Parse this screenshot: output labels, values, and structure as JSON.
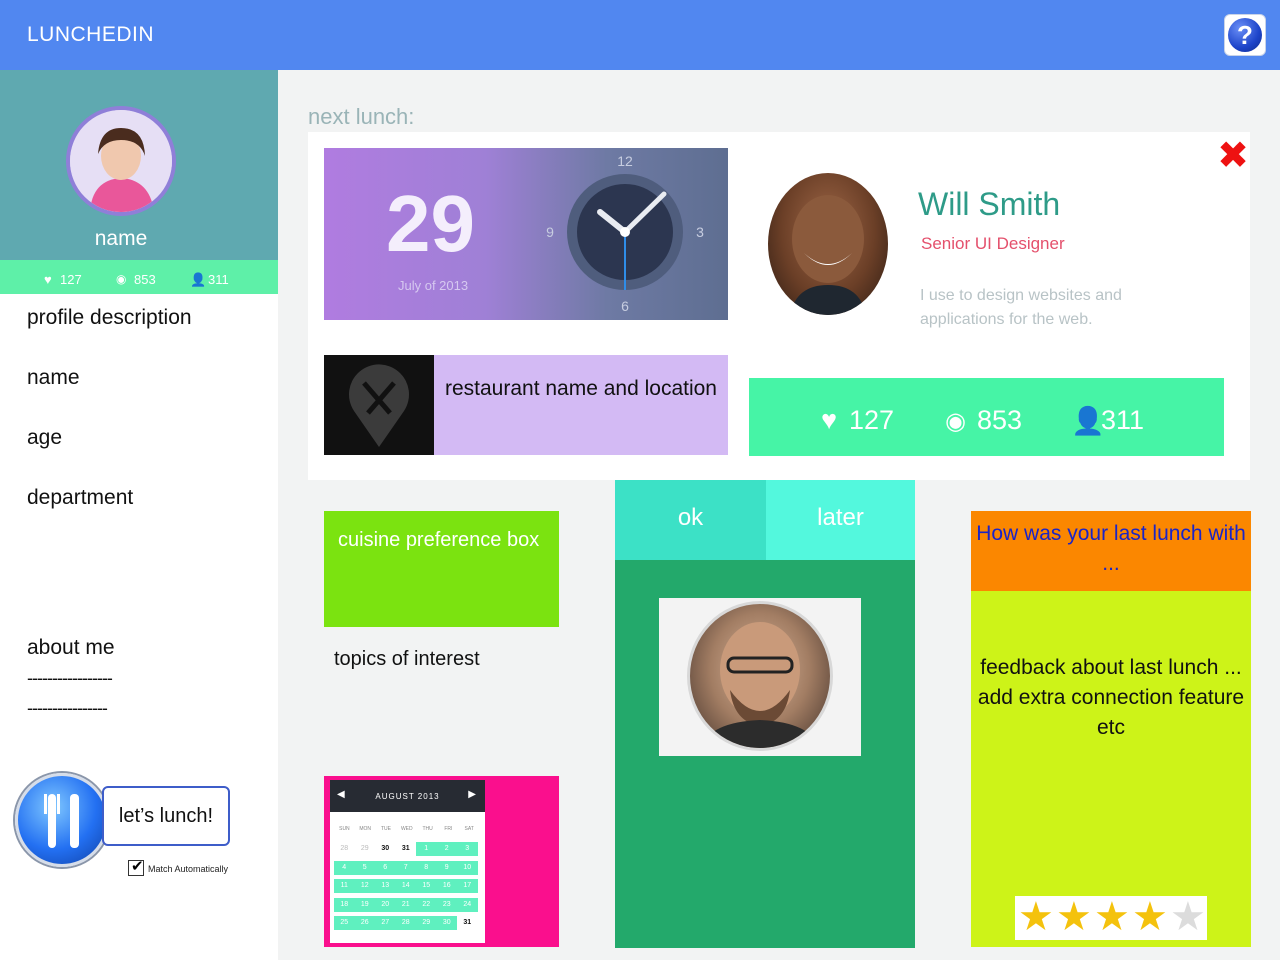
{
  "header": {
    "title": "LUNCHEDIN",
    "help_glyph": "?"
  },
  "sidebar": {
    "profile_name": "name",
    "stats": {
      "likes": "127",
      "views": "853",
      "friends": "311"
    },
    "labels": [
      "profile description",
      "name",
      "age",
      "department"
    ],
    "about_label": "about me",
    "dash_1": "-----------------",
    "dash_2": "----------------",
    "lunch_button": "let’s lunch!",
    "match_auto": "Match Automatically",
    "match_checked": true
  },
  "next_lunch": {
    "label": "next lunch:",
    "day": "29",
    "date_text": "July of 2013",
    "clock_numbers": {
      "twelve": "12",
      "three": "3",
      "six": "6",
      "nine": "9"
    },
    "restaurant": "restaurant name and location",
    "person": {
      "name": "Will Smith",
      "title": "Senior UI Designer",
      "description": "I use to design websites and applications for the web."
    },
    "stats": {
      "likes": "127",
      "views": "853",
      "friends": "311"
    }
  },
  "cuisine_box": "cuisine preference box",
  "topics": "topics of interest",
  "calendar": {
    "month": "AUGUST 2013",
    "days": [
      "SUN",
      "MON",
      "TUE",
      "WED",
      "THU",
      "FRI",
      "SAT"
    ],
    "rows": [
      [
        "28",
        "29",
        "30",
        "31",
        "1",
        "2",
        "3"
      ],
      [
        "4",
        "5",
        "6",
        "7",
        "8",
        "9",
        "10"
      ],
      [
        "11",
        "12",
        "13",
        "14",
        "15",
        "16",
        "17"
      ],
      [
        "18",
        "19",
        "20",
        "21",
        "22",
        "23",
        "24"
      ],
      [
        "25",
        "26",
        "27",
        "28",
        "29",
        "30",
        "31"
      ]
    ]
  },
  "match": {
    "ok": "ok",
    "later": "later"
  },
  "feedback": {
    "header": "How was your last lunch with ...",
    "body": "feedback about last lunch ... add extra connection feature etc",
    "rating": 4,
    "max_rating": 5
  },
  "colors": {
    "header": "#5187f0",
    "profile_head": "#5fa9b0",
    "stats_green": "#46f4a6",
    "cuisine": "#7be310",
    "calendar_panel": "#fa0f8d",
    "mid_column": "#23a96b",
    "feedback_head": "#fb8700",
    "feedback_body": "#cdf318"
  }
}
